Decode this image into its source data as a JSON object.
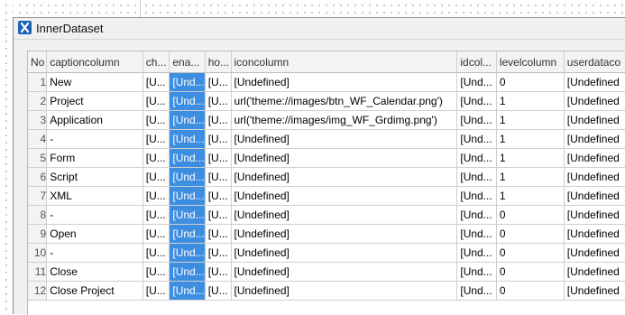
{
  "window": {
    "title": "InnerDataset",
    "icon": "x-app-icon"
  },
  "grid": {
    "columns": [
      "No",
      "captioncolumn",
      "ch...",
      "ena...",
      "ho...",
      "iconcolumn",
      "idcol...",
      "levelcolumn",
      "userdataco"
    ],
    "selected_column": 3,
    "rows": [
      [
        "1",
        "New",
        "[U...",
        "[Und...",
        "[U...",
        "[Undefined]",
        "[Und...",
        "0",
        "[Undefined"
      ],
      [
        "2",
        "Project",
        "[U...",
        "[Und...",
        "[U...",
        "url('theme://images/btn_WF_Calendar.png')",
        "[Und...",
        "1",
        "[Undefined"
      ],
      [
        "3",
        "Application",
        "[U...",
        "[Und...",
        "[U...",
        "url('theme://images/img_WF_Grdimg.png')",
        "[Und...",
        "1",
        "[Undefined"
      ],
      [
        "4",
        "-",
        "[U...",
        "[Und...",
        "[U...",
        "[Undefined]",
        "[Und...",
        "1",
        "[Undefined"
      ],
      [
        "5",
        "Form",
        "[U...",
        "[Und...",
        "[U...",
        "[Undefined]",
        "[Und...",
        "1",
        "[Undefined"
      ],
      [
        "6",
        "Script",
        "[U...",
        "[Und...",
        "[U...",
        "[Undefined]",
        "[Und...",
        "1",
        "[Undefined"
      ],
      [
        "7",
        "XML",
        "[U...",
        "[Und...",
        "[U...",
        "[Undefined]",
        "[Und...",
        "1",
        "[Undefined"
      ],
      [
        "8",
        "-",
        "[U...",
        "[Und...",
        "[U...",
        "[Undefined]",
        "[Und...",
        "0",
        "[Undefined"
      ],
      [
        "9",
        "Open",
        "[U...",
        "[Und...",
        "[U...",
        "[Undefined]",
        "[Und...",
        "0",
        "[Undefined"
      ],
      [
        "10",
        "-",
        "[U...",
        "[Und...",
        "[U...",
        "[Undefined]",
        "[Und...",
        "0",
        "[Undefined"
      ],
      [
        "11",
        "Close",
        "[U...",
        "[Und...",
        "[U...",
        "[Undefined]",
        "[Und...",
        "0",
        "[Undefined"
      ],
      [
        "12",
        "Close Project",
        "[U...",
        "[Und...",
        "[U...",
        "[Undefined]",
        "[Und...",
        "0",
        "[Undefined"
      ]
    ]
  },
  "colors": {
    "selection": "#3d8ee0",
    "header_bg": "#f3f3f3",
    "window_bg": "#f0f0f0"
  }
}
